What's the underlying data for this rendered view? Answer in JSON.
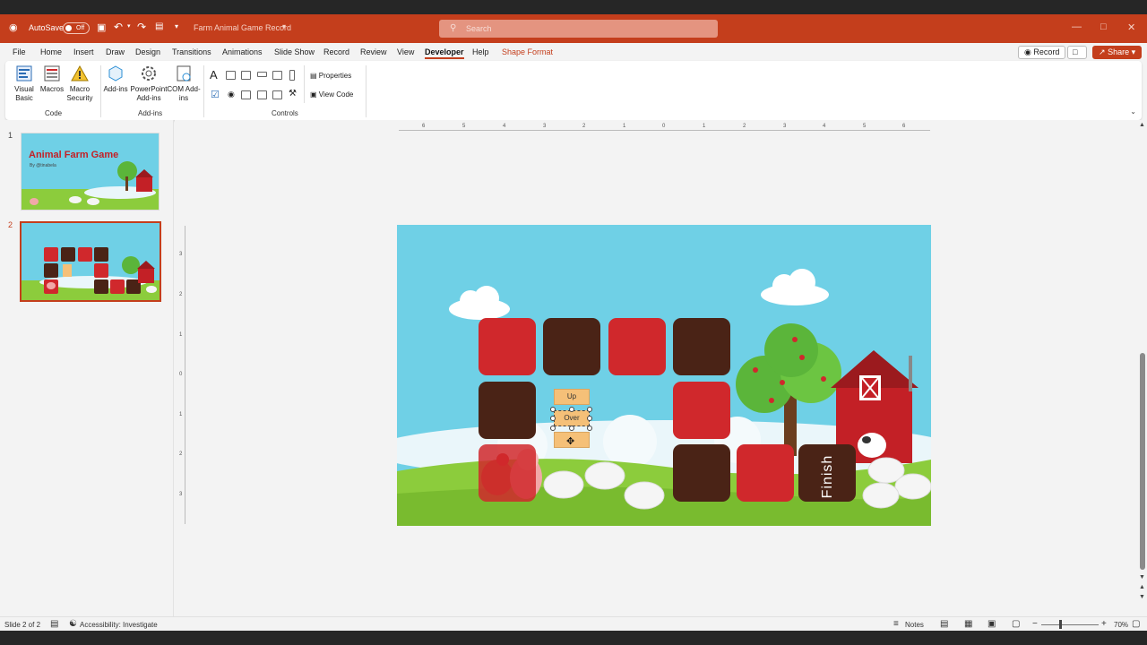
{
  "title_bar": {
    "autosave_label": "AutoSave",
    "autosave_state": "Off",
    "document_title": "Farm Animal Game Record",
    "search_placeholder": "Search"
  },
  "tabs": [
    "File",
    "Home",
    "Insert",
    "Draw",
    "Design",
    "Transitions",
    "Animations",
    "Slide Show",
    "Record",
    "Review",
    "View",
    "Developer",
    "Help",
    "Shape Format"
  ],
  "active_tab": "Developer",
  "header_buttons": {
    "record": "Record",
    "share": "Share"
  },
  "ribbon": {
    "code": {
      "group": "Code",
      "visual_basic": "Visual Basic",
      "macros": "Macros",
      "macro_security": "Macro Security"
    },
    "addins": {
      "group": "Add-ins",
      "add_ins": "Add-ins",
      "powerpoint_addins": "PowerPoint Add-ins",
      "com_addins": "COM Add-ins"
    },
    "controls": {
      "group": "Controls",
      "properties": "Properties",
      "view_code": "View Code"
    }
  },
  "thumbnails": [
    {
      "number": "1",
      "title": "Animal Farm Game",
      "byline": "By @tinabela"
    },
    {
      "number": "2"
    }
  ],
  "ruler": {
    "horizontal": [
      "6",
      "5",
      "4",
      "3",
      "2",
      "1",
      "0",
      "1",
      "2",
      "3",
      "4",
      "5",
      "6"
    ],
    "vertical": [
      "3",
      "2",
      "1",
      "0",
      "1",
      "2",
      "3"
    ]
  },
  "slide": {
    "buttons": [
      "Up",
      "Over",
      ""
    ],
    "finish_label": "Finish"
  },
  "status": {
    "slide_info": "Slide 2 of 2",
    "accessibility": "Accessibility: Investigate",
    "notes": "Notes",
    "zoom": "70%"
  },
  "colors": {
    "accent": "#c43e1c",
    "tile_red": "#d0282c",
    "tile_brown": "#4a2316",
    "sky": "#6fd0e6"
  }
}
